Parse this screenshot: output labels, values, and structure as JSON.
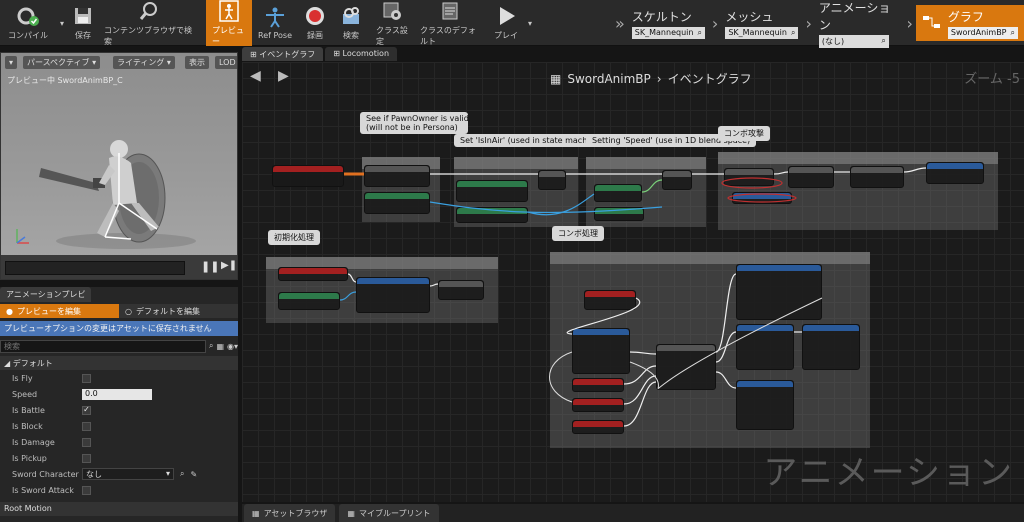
{
  "toolbar": {
    "buttons": [
      {
        "label": "コンパイル",
        "icon": "compile-icon"
      },
      {
        "label": "保存",
        "icon": "save-icon"
      },
      {
        "label": "コンテンツブラウザで検索",
        "icon": "find-in-cb-icon"
      },
      {
        "label": "プレビュー",
        "icon": "preview-icon"
      },
      {
        "label": "Ref Pose",
        "icon": "ref-pose-icon"
      },
      {
        "label": "録画",
        "icon": "record-icon"
      },
      {
        "label": "検索",
        "icon": "search-icon"
      },
      {
        "label": "クラス設定",
        "icon": "class-settings-icon"
      },
      {
        "label": "クラスのデフォルト",
        "icon": "class-defaults-icon"
      },
      {
        "label": "プレイ",
        "icon": "play-icon"
      }
    ]
  },
  "modes": {
    "skeleton": {
      "title": "スケルトン",
      "value": "SK_Mannequin"
    },
    "mesh": {
      "title": "メッシュ",
      "value": "SK_Mannequin"
    },
    "animation": {
      "title": "アニメーション",
      "value": "(なし)"
    },
    "graph": {
      "title": "グラフ",
      "value": "SwordAnimBP"
    }
  },
  "viewport": {
    "perspective": "パースペクティブ",
    "lighting": "ライティング",
    "show": "表示",
    "lod": "LOD",
    "preview_label": "プレビュー中 SwordAnimBP_C"
  },
  "details": {
    "tab": "アニメーションプレビ",
    "edit_preview": "プレビューを編集",
    "edit_defaults": "デフォルトを編集",
    "notice": "プレビューオプションの変更はアセットに保存されません",
    "search_placeholder": "検索",
    "section_default": "デフォルト",
    "props": {
      "is_fly": "Is Fly",
      "speed": "Speed",
      "speed_value": "0.0",
      "is_battle": "Is Battle",
      "is_block": "Is Block",
      "is_damage": "Is Damage",
      "is_pickup": "Is Pickup",
      "sword_character": "Sword Character",
      "sword_character_value": "なし",
      "is_sword_attack": "Is Sword Attack"
    },
    "section_root_motion": "Root Motion"
  },
  "graph": {
    "tabs": [
      "イベントグラフ",
      "Locomotion"
    ],
    "breadcrumb_bp": "SwordAnimBP",
    "breadcrumb_graph": "イベントグラフ",
    "zoom": "ズーム -5",
    "watermark": "アニメーション",
    "bubbles": {
      "pawn": "See if PawnOwner is valid\n(will not be in Persona)",
      "isinair": "Set 'IsInAir' (used in state machine)",
      "speed": "Setting 'Speed' (use in 1D blend space)",
      "combo_attack": "コンボ攻撃",
      "init": "初期化処理",
      "combo_proc": "コンボ処理"
    }
  },
  "bottom_tabs": [
    "アセットブラウザ",
    "マイブループリント"
  ]
}
